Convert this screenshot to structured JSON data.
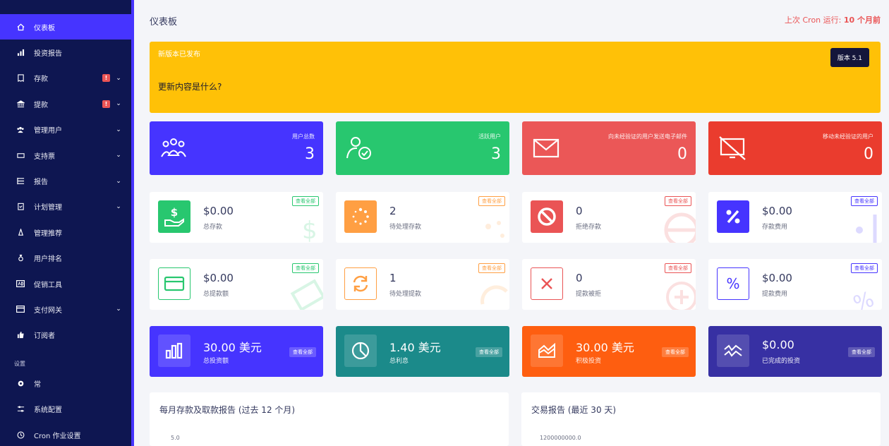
{
  "sidebar": {
    "items": [
      {
        "label": "仪表板",
        "icon": "home-icon",
        "active": true,
        "badge": "",
        "chevron": false
      },
      {
        "label": "投资报告",
        "icon": "bar-chart-icon",
        "active": false,
        "badge": "",
        "chevron": false
      },
      {
        "label": "存款",
        "icon": "receipt-icon",
        "active": false,
        "badge": "!",
        "chevron": true
      },
      {
        "label": "提款",
        "icon": "bank-icon",
        "active": false,
        "badge": "!",
        "chevron": true
      },
      {
        "label": "管理用户",
        "icon": "users-icon",
        "active": false,
        "badge": "",
        "chevron": true
      },
      {
        "label": "支持票",
        "icon": "ticket-icon",
        "active": false,
        "badge": "",
        "chevron": true
      },
      {
        "label": "报告",
        "icon": "list-icon",
        "active": false,
        "badge": "",
        "chevron": true
      },
      {
        "label": "计划管理",
        "icon": "clipboard-icon",
        "active": false,
        "badge": "",
        "chevron": true
      },
      {
        "label": "管理推荐",
        "icon": "referral-icon",
        "active": false,
        "badge": "",
        "chevron": false
      },
      {
        "label": "用户排名",
        "icon": "medal-icon",
        "active": false,
        "badge": "",
        "chevron": false
      },
      {
        "label": "促销工具",
        "icon": "ad-icon",
        "active": false,
        "badge": "",
        "chevron": false
      },
      {
        "label": "支付网关",
        "icon": "credit-card-icon",
        "active": false,
        "badge": "",
        "chevron": true
      },
      {
        "label": "订阅者",
        "icon": "thumbs-up-icon",
        "active": false,
        "badge": "",
        "chevron": false
      }
    ],
    "settings_title": "设置",
    "settings_items": [
      {
        "label": "常",
        "icon": "gear-icon"
      },
      {
        "label": "系统配置",
        "icon": "sliders-icon"
      },
      {
        "label": "Cron 作业设置",
        "icon": "clock-icon"
      }
    ]
  },
  "header": {
    "title": "仪表板",
    "cron_label": "上次 Cron 运行:",
    "cron_value": "10 个月前"
  },
  "banner": {
    "title": "新版本已发布",
    "subtitle": "更新内容是什么?",
    "version": "版本 5.1"
  },
  "stats": [
    {
      "label": "用户总数",
      "value": "3",
      "color": "#4634ff",
      "icon": "users-group-icon"
    },
    {
      "label": "活跃用户",
      "value": "3",
      "color": "#28c76f",
      "icon": "user-check-icon"
    },
    {
      "label": "向未经验证的用户发送电子邮件",
      "value": "0",
      "color": "#eb5757",
      "icon": "envelope-icon"
    },
    {
      "label": "移动未经验证的用户",
      "value": "0",
      "color": "#ea3c2e",
      "icon": "mobile-off-icon"
    }
  ],
  "deposit_cards": [
    {
      "value": "$0.00",
      "label": "总存款",
      "view_all": "查看全部",
      "color": "#28c76f",
      "icon": "hand-dollar-icon"
    },
    {
      "value": "2",
      "label": "待处理存款",
      "view_all": "查看全部",
      "color": "#ff9f43",
      "icon": "spinner-icon"
    },
    {
      "value": "0",
      "label": "拒绝存款",
      "view_all": "查看全部",
      "color": "#ea5455",
      "icon": "ban-icon"
    },
    {
      "value": "$0.00",
      "label": "存款费用",
      "view_all": "查看全部",
      "color": "#4634ff",
      "icon": "percent-icon"
    }
  ],
  "withdraw_cards": [
    {
      "value": "$0.00",
      "label": "总提款额",
      "view_all": "查看全部",
      "color": "#28c76f",
      "icon": "card-icon"
    },
    {
      "value": "1",
      "label": "待处理提款",
      "view_all": "查看全部",
      "color": "#ff9f43",
      "icon": "refresh-icon"
    },
    {
      "value": "0",
      "label": "提款被拒",
      "view_all": "查看全部",
      "color": "#ea5455",
      "icon": "x-icon"
    },
    {
      "value": "$0.00",
      "label": "提款费用",
      "view_all": "查看全部",
      "color": "#4634ff",
      "icon": "percent-outline-icon"
    }
  ],
  "invest_cards": [
    {
      "value": "30.00 美元",
      "label": "总投资额",
      "view_all": "查看全部",
      "color": "#4634ff",
      "icon": "bars-icon"
    },
    {
      "value": "1.40 美元",
      "label": "总利息",
      "view_all": "查看全部",
      "color": "#1b8a8a",
      "icon": "pie-icon"
    },
    {
      "value": "30.00 美元",
      "label": "积极投资",
      "view_all": "查看全部",
      "color": "#fe5e10",
      "icon": "area-chart-icon"
    },
    {
      "value": "$0.00",
      "label": "已完成的投资",
      "view_all": "查看全部",
      "color": "#3730a3",
      "icon": "wave-icon"
    }
  ],
  "panels": [
    {
      "title": "每月存款及取款报告 (过去 12 个月)",
      "axis": "5.0"
    },
    {
      "title": "交易报告 (最近 30 天)",
      "axis": "1200000000.0"
    }
  ]
}
